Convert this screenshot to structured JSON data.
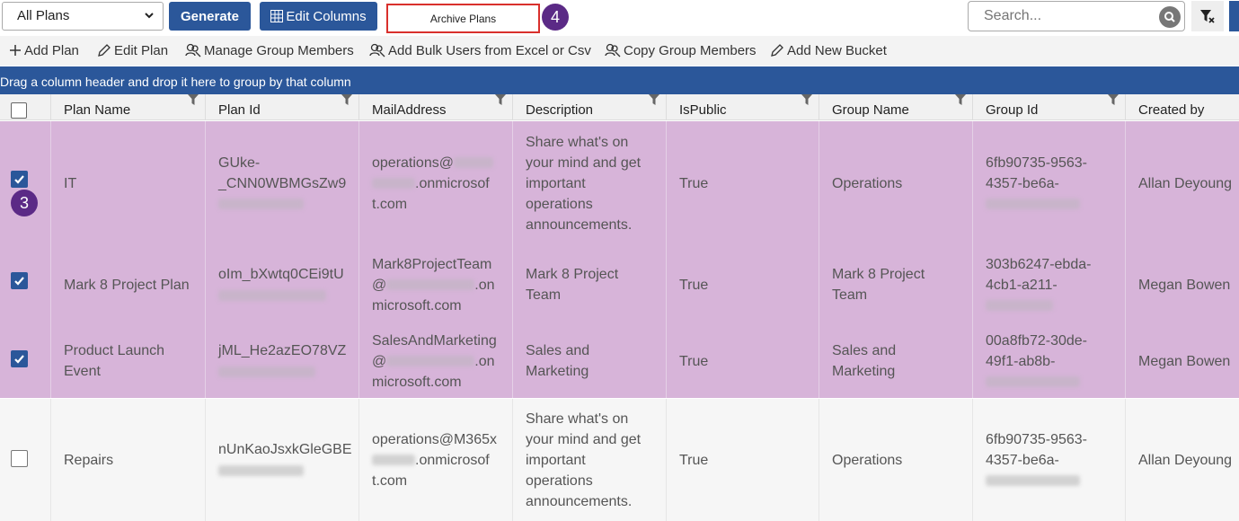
{
  "topbar": {
    "plan_select_value": "All Plans",
    "generate_label": "Generate",
    "edit_columns_label": "Edit Columns",
    "archive_plans_label": "Archive Plans",
    "step4": "4",
    "search_placeholder": "Search..."
  },
  "toolbar": {
    "add_plan": "Add Plan",
    "edit_plan": "Edit Plan",
    "manage_group_members": "Manage Group Members",
    "add_bulk_users": "Add Bulk Users from Excel or Csv",
    "copy_group_members": "Copy Group Members",
    "add_new_bucket": "Add New Bucket"
  },
  "group_bar_text": "Drag a column header and drop it here to group by that column",
  "columns": [
    "Plan Name",
    "Plan Id",
    "MailAddress",
    "Description",
    "IsPublic",
    "Group Name",
    "Group Id",
    "Created by"
  ],
  "step3": "3",
  "rows": [
    {
      "checked": true,
      "plan_name": "IT",
      "plan_id": "GUke-\n_CNN0WBMGsZw9",
      "mail_a": "operations@",
      "mail_b": ".onmicrosof\nt.com",
      "description": "Share what's on\nyour mind and get\nimportant\noperations\nannouncements.",
      "is_public": "True",
      "group_name": "Operations",
      "group_id": "6fb90735-9563-\n4357-be6a-",
      "created_by": "Allan Deyoung"
    },
    {
      "checked": true,
      "plan_name": "Mark 8 Project Plan",
      "plan_id": "oIm_bXwtq0CEi9tU",
      "mail_a": "Mark8ProjectTeam\n@",
      "mail_b": ".on\nmicrosoft.com",
      "description": "Mark 8 Project\nTeam",
      "is_public": "True",
      "group_name": "Mark 8 Project\nTeam",
      "group_id": "303b6247-ebda-\n4cb1-a211-",
      "created_by": "Megan Bowen"
    },
    {
      "checked": true,
      "plan_name": "Product Launch\nEvent",
      "plan_id": "jML_He2azEO78VZ",
      "mail_a": "SalesAndMarketing\n@",
      "mail_b": ".on\nmicrosoft.com",
      "description": "Sales and\nMarketing",
      "is_public": "True",
      "group_name": "Sales and\nMarketing",
      "group_id": "00a8fb72-30de-\n49f1-ab8b-",
      "created_by": "Megan Bowen"
    },
    {
      "checked": false,
      "plan_name": "Repairs",
      "plan_id": "nUnKaoJsxkGleGBE",
      "mail_a": "operations@M365x",
      "mail_b": ".onmicrosof\nt.com",
      "description": "Share what's on\nyour mind and get\nimportant\noperations\nannouncements.",
      "is_public": "True",
      "group_name": "Operations",
      "group_id": "6fb90735-9563-\n4357-be6a-",
      "created_by": "Allan Deyoung"
    }
  ],
  "colors": {
    "accent": "#2b579a",
    "selected_row": "#d7b4d9",
    "highlight_border": "#d9302c",
    "step_badge": "#5b2a86"
  }
}
